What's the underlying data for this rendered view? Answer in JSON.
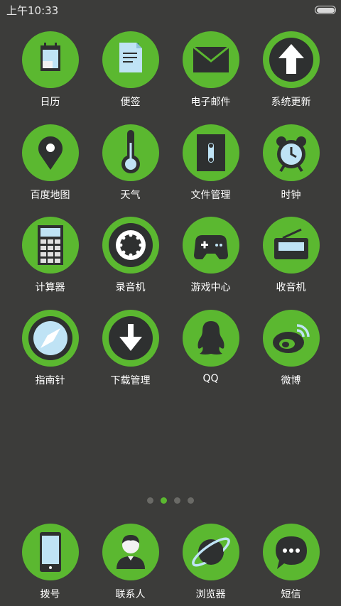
{
  "status_bar": {
    "time": "上午10:33",
    "battery_level": 1.0
  },
  "colors": {
    "background": "#3c3c3a",
    "icon_green": "#5bb830",
    "icon_dark": "#2e3030",
    "icon_light_blue": "#bfe3f5"
  },
  "apps": [
    {
      "label": "日历",
      "icon": "calendar-icon"
    },
    {
      "label": "便签",
      "icon": "notes-icon"
    },
    {
      "label": "电子邮件",
      "icon": "email-icon"
    },
    {
      "label": "系统更新",
      "icon": "system-update-icon"
    },
    {
      "label": "百度地图",
      "icon": "map-pin-icon"
    },
    {
      "label": "天气",
      "icon": "thermometer-icon"
    },
    {
      "label": "文件管理",
      "icon": "file-manager-icon"
    },
    {
      "label": "时钟",
      "icon": "alarm-clock-icon"
    },
    {
      "label": "计算器",
      "icon": "calculator-icon"
    },
    {
      "label": "录音机",
      "icon": "recorder-icon"
    },
    {
      "label": "游戏中心",
      "icon": "gamepad-icon"
    },
    {
      "label": "收音机",
      "icon": "radio-icon"
    },
    {
      "label": "指南针",
      "icon": "compass-icon"
    },
    {
      "label": "下载管理",
      "icon": "download-icon"
    },
    {
      "label": "QQ",
      "icon": "qq-penguin-icon"
    },
    {
      "label": "微博",
      "icon": "weibo-icon"
    }
  ],
  "pager": {
    "page_count": 4,
    "current_page": 2
  },
  "dock": [
    {
      "label": "拨号",
      "icon": "phone-icon"
    },
    {
      "label": "联系人",
      "icon": "contacts-icon"
    },
    {
      "label": "浏览器",
      "icon": "browser-planet-icon"
    },
    {
      "label": "短信",
      "icon": "message-bubble-icon"
    }
  ]
}
